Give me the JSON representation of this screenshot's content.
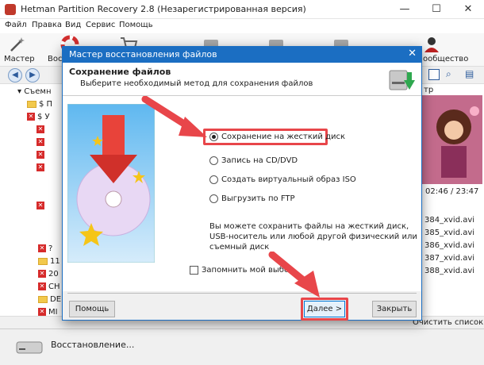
{
  "window": {
    "title": "Hetman Partition Recovery 2.8 (Незарегистрированная версия)",
    "controls": [
      "—",
      "☐",
      "✕"
    ]
  },
  "menu": [
    "Файл",
    "Правка",
    "Вид",
    "Сервис",
    "Помощь"
  ],
  "toolbar": {
    "wizard_label": "Мастер",
    "recovery_label_partial": "Вос",
    "community_label_partial": "ообщество"
  },
  "tree": {
    "items": [
      "Съемн",
      "$ П",
      "$ У",
      "?",
      "11",
      "20",
      "CH",
      "DE",
      "MI"
    ]
  },
  "right_pane": {
    "preview_label": "тр",
    "time": "02:46 / 23:47",
    "files": [
      "384_xvid.avi",
      "385_xvid.avi",
      "386_xvid.avi",
      "387_xvid.avi",
      "388_xvid.avi"
    ],
    "clear_list": "Очистить список"
  },
  "status": {
    "text": "Восстановление..."
  },
  "dialog": {
    "title": "Мастер восстановления файлов",
    "close": "✕",
    "heading": "Сохранение файлов",
    "subheading": "Выберите необходимый метод для сохранения файлов",
    "options": [
      {
        "label": "Сохранение на жесткий диск",
        "selected": true
      },
      {
        "label": "Запись на CD/DVD",
        "selected": false
      },
      {
        "label": "Создать виртуальный образ ISO",
        "selected": false
      },
      {
        "label": "Выгрузить по FTP",
        "selected": false
      }
    ],
    "description": "Вы можете сохранить файлы на жесткий диск, USB-носитель или любой другой физический или съемный диск",
    "remember": "Запомнить мой выбор",
    "buttons": {
      "help": "Помощь",
      "next": "Далее >",
      "close": "Закрыть"
    }
  },
  "colors": {
    "accent": "#1b6ec2",
    "highlight": "#e8464a"
  }
}
